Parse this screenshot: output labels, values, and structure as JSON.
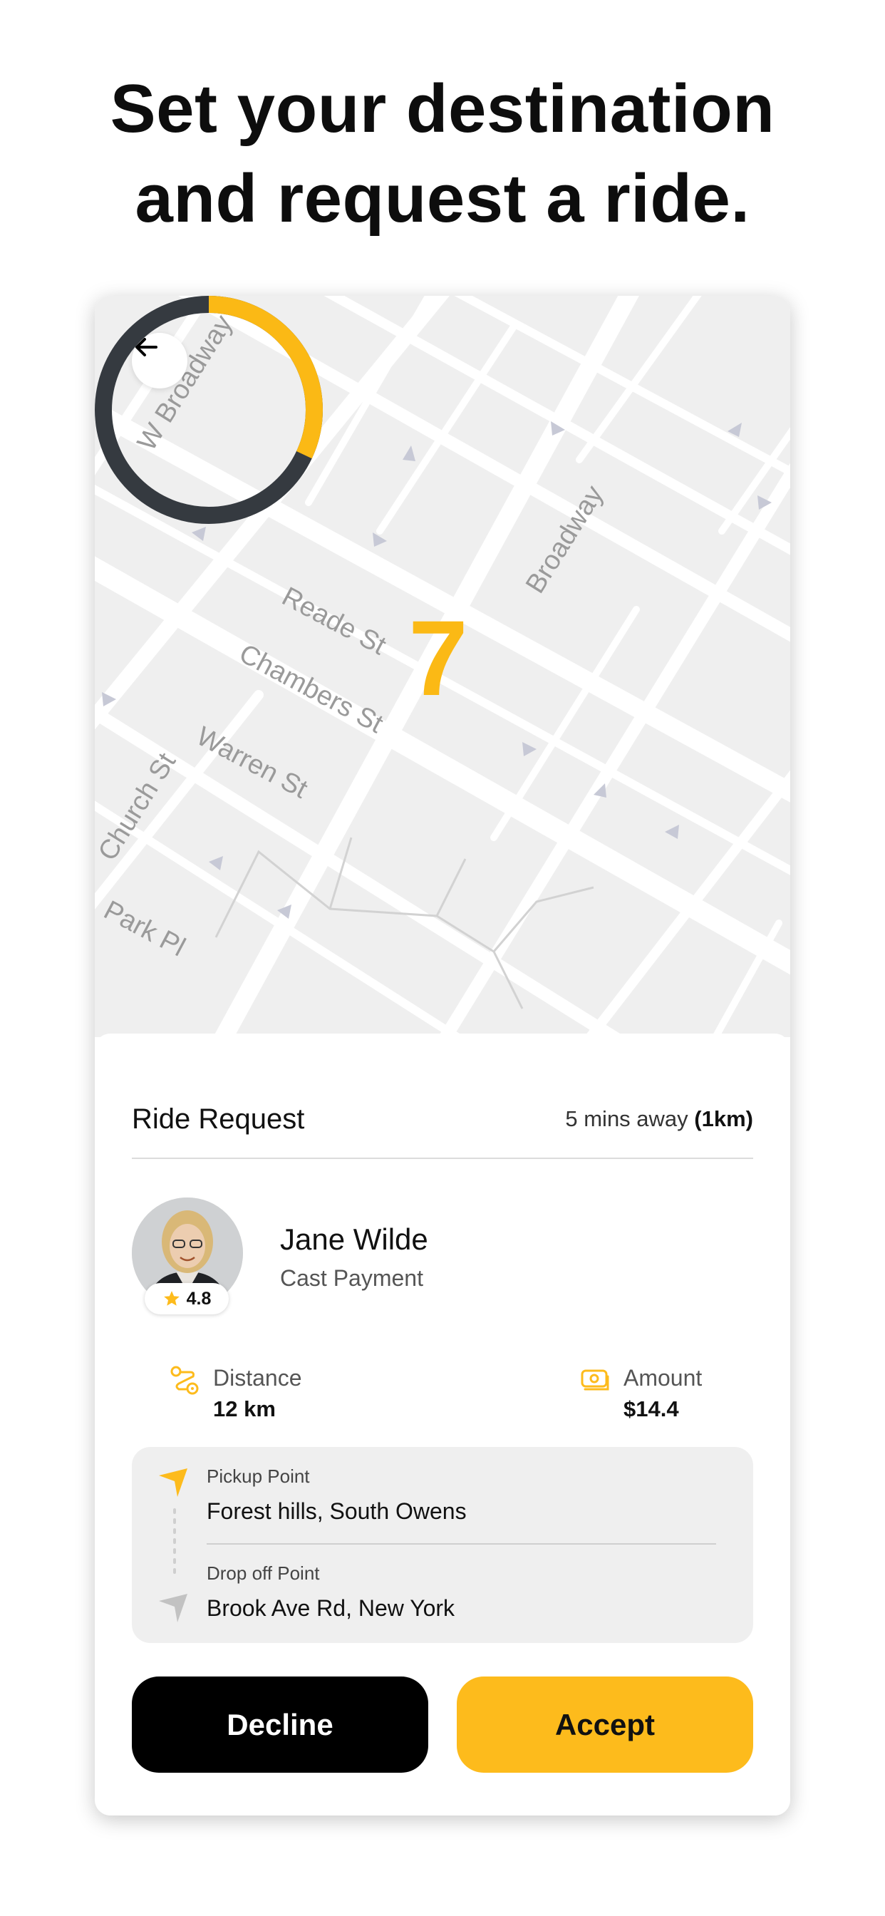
{
  "headline": [
    "Set your destination",
    "and request a ride."
  ],
  "map": {
    "street_labels": [
      "W Broadway",
      "Broadway",
      "Reade St",
      "Chambers St",
      "Church St",
      "Warren St",
      "Park Pl"
    ],
    "countdown": "7",
    "countdown_progress_percent": 32
  },
  "ride_request": {
    "title": "Ride Request",
    "eta_text": "5 mins away",
    "eta_distance": "(1km)"
  },
  "driver": {
    "name": "Jane Wilde",
    "payment": "Cast Payment",
    "rating": "4.8"
  },
  "stats": {
    "distance_label": "Distance",
    "distance_value": "12 km",
    "amount_label": "Amount",
    "amount_value": "$14.4"
  },
  "route": {
    "pickup_label": "Pickup Point",
    "pickup_value": "Forest hills, South Owens",
    "dropoff_label": "Drop off Point",
    "dropoff_value": "Brook Ave Rd, New York"
  },
  "actions": {
    "decline": "Decline",
    "accept": "Accept"
  },
  "colors": {
    "accent": "#fdbb1c",
    "ring_dark": "#353a40",
    "decline_bg": "#000000"
  },
  "icons": [
    "arrow-left-icon",
    "star-icon",
    "route-distance-icon",
    "cash-icon",
    "navigation-arrow-icon"
  ]
}
